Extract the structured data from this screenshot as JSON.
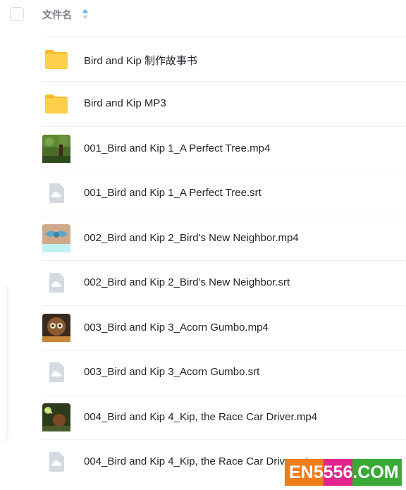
{
  "header": {
    "column_label": "文件名",
    "sort_icon": "sort-arrows-icon"
  },
  "files": [
    {
      "name": "Bird and Kip 制作故事书",
      "icon": "folder-icon"
    },
    {
      "name": "Bird and Kip MP3",
      "icon": "folder-icon"
    },
    {
      "name": "001_Bird and Kip 1_A Perfect Tree.mp4",
      "icon": "video-thumbnail"
    },
    {
      "name": "001_Bird and Kip 1_A Perfect Tree.srt",
      "icon": "cloud-file-icon"
    },
    {
      "name": "002_Bird and Kip 2_Bird's New Neighbor.mp4",
      "icon": "video-thumbnail"
    },
    {
      "name": "002_Bird and Kip 2_Bird's New Neighbor.srt",
      "icon": "cloud-file-icon"
    },
    {
      "name": "003_Bird and Kip 3_Acorn Gumbo.mp4",
      "icon": "video-thumbnail"
    },
    {
      "name": "003_Bird and Kip 3_Acorn Gumbo.srt",
      "icon": "cloud-file-icon"
    },
    {
      "name": "004_Bird and Kip 4_Kip, the Race Car Driver.mp4",
      "icon": "video-thumbnail"
    },
    {
      "name": "004_Bird and Kip 4_Kip, the Race Car Driver.srt",
      "icon": "cloud-file-icon"
    }
  ],
  "watermark": {
    "part1": "EN5",
    "part2": "556",
    "part3": ".COM"
  },
  "colors": {
    "folder": "#fcc93b",
    "text": "#1f2329",
    "header_text": "#7b7f8a",
    "divider": "#eef0f3",
    "watermark_orange": "#ef7d1a",
    "watermark_pink": "#e2248c",
    "watermark_green": "#3aa935"
  }
}
